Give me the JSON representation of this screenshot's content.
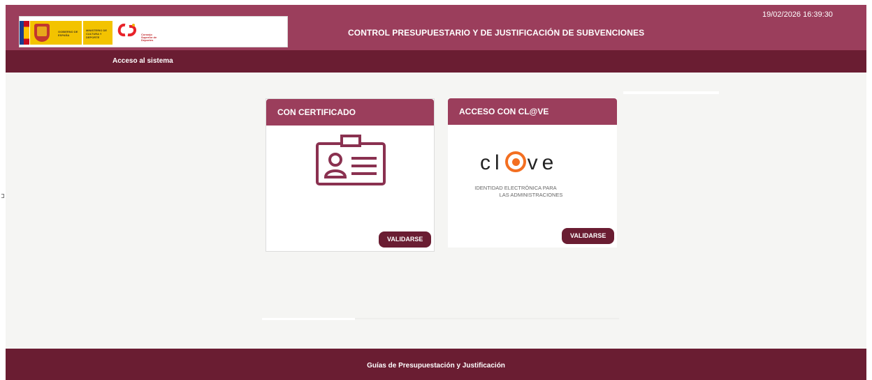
{
  "header": {
    "title": "CONTROL PRESUPUESTARIO Y DE JUSTIFICACIÓN DE SUBVENCIONES",
    "datetime": "19/02/2026 16:39:30",
    "logos": {
      "gobierno": "GOBIERNO DE ESPAÑA",
      "ministerio": "MINISTERIO DE CULTURA Y DEPORTE",
      "csd": "Consejo Superior de Deportes"
    }
  },
  "subbar": {
    "label": "Acceso al sistema"
  },
  "cards": {
    "certificado": {
      "title": "CON CERTIFICADO",
      "button": "VALIDARSE",
      "icon": "id-card-icon"
    },
    "clave": {
      "title": "ACCESO CON CL@VE",
      "button": "VALIDARSE",
      "logo_left": "cl",
      "logo_right": "ve",
      "subtitle_line1": "IDENTIDAD ELECTRÓNICA PARA",
      "subtitle_line2": "LAS ADMINISTRACIONES"
    }
  },
  "footer": {
    "link": "Guías de Presupuestación y Justificación"
  },
  "colors": {
    "primary": "#9b3e5c",
    "dark": "#6a1d32",
    "background": "#f5f5f3",
    "clave_orange": "#f36f21"
  }
}
